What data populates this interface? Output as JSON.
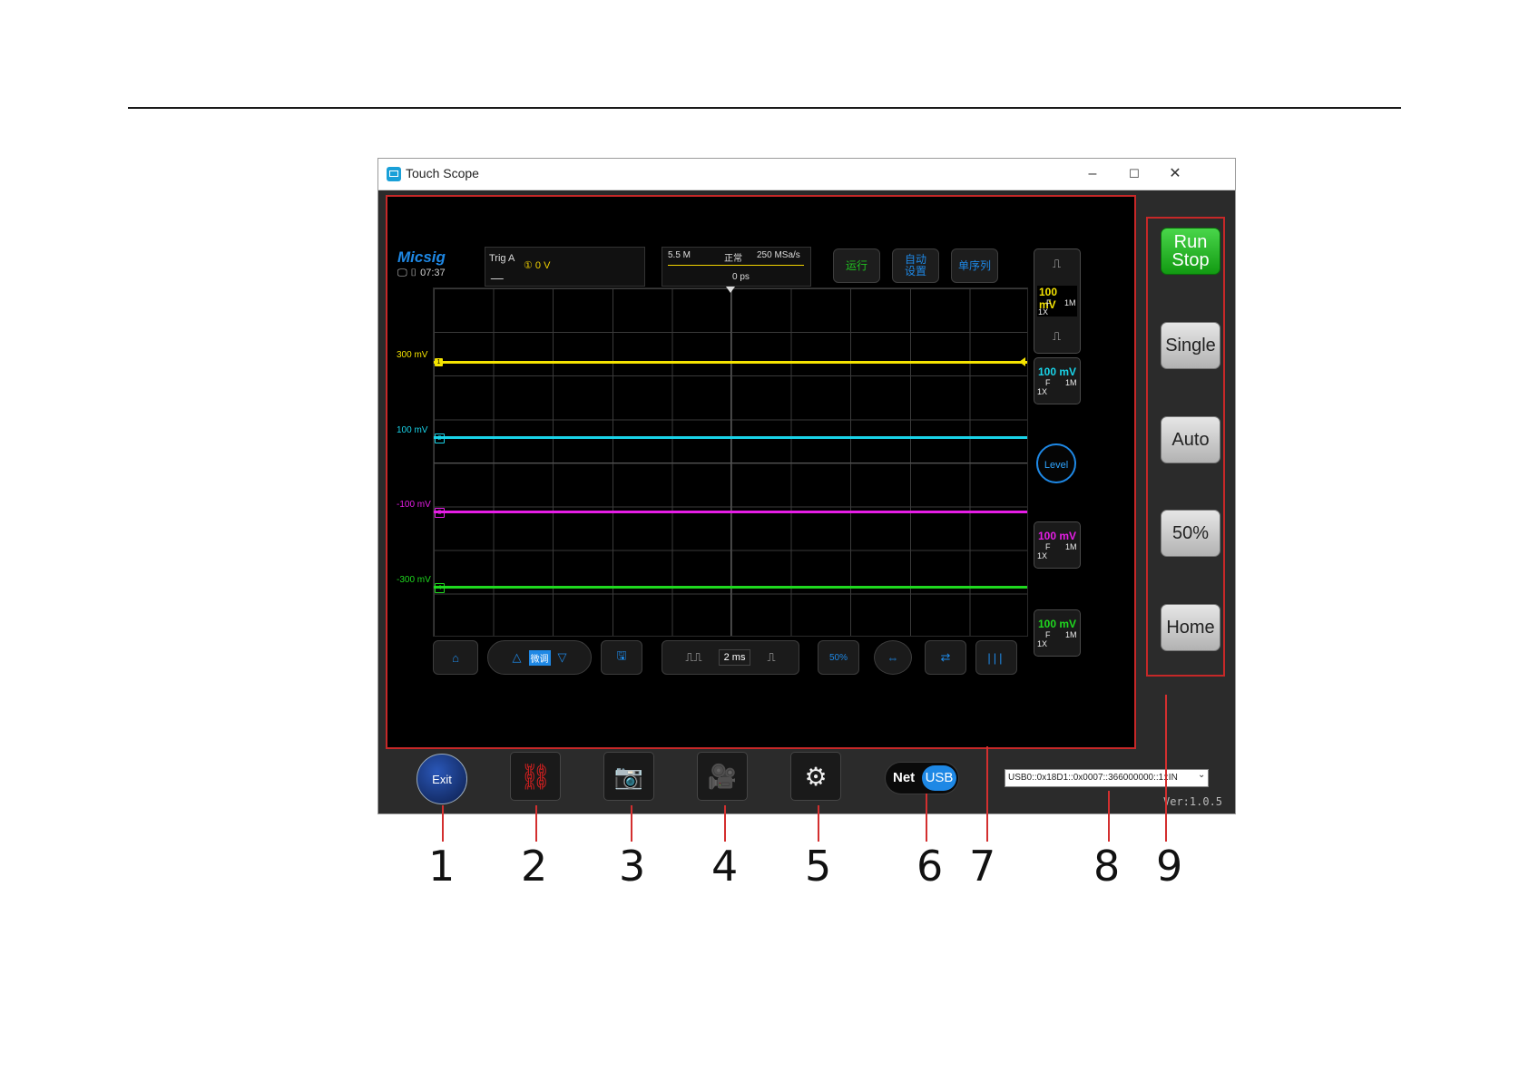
{
  "window": {
    "title": "Touch Scope",
    "min_glyph": "–",
    "max_glyph": "☐",
    "close_glyph": "✕"
  },
  "scope": {
    "logo": "Micsig",
    "clock": "07:37",
    "trigger": {
      "label": "Trig  A",
      "value": "① 0  V"
    },
    "timebase": {
      "memory": "5.5 M",
      "mode": "正常",
      "sample_rate": "250 MSa/s",
      "position": "0 ps"
    },
    "top_buttons": [
      "运行",
      "自动\n设置",
      "单序列"
    ],
    "channels": [
      {
        "offset_label": "300 mV",
        "mark": "1",
        "color": "#f4e300",
        "volts": "100 mV",
        "coupling": "F",
        "impedance": "1M",
        "probe": "1X"
      },
      {
        "offset_label": "100 mV",
        "mark": "2",
        "color": "#19d3e8",
        "volts": "100 mV",
        "coupling": "F",
        "impedance": "1M",
        "probe": "1X"
      },
      {
        "offset_label": "-100 mV",
        "mark": "3",
        "color": "#e61de6",
        "volts": "100 mV",
        "coupling": "F",
        "impedance": "1M",
        "probe": "1X"
      },
      {
        "offset_label": "-300 mV",
        "mark": "4",
        "color": "#1fd81f",
        "volts": "100 mV",
        "coupling": "F",
        "impedance": "1M",
        "probe": "1X"
      }
    ],
    "level_label": "Level",
    "fine_label": "微调",
    "time_div": "2 ms",
    "fifty_label": "50%"
  },
  "right_panel": {
    "run_stop": "Run\nStop",
    "single": "Single",
    "auto": "Auto",
    "fifty": "50%",
    "home": "Home"
  },
  "bottom_bar": {
    "exit": "Exit",
    "net": "Net",
    "usb": "USB",
    "device": "USB0::0x18D1::0x0007::366000000::1::IN",
    "version": "Ver:1.0.5"
  },
  "callouts": [
    "1",
    "2",
    "3",
    "4",
    "5",
    "6",
    "7",
    "8",
    "9"
  ]
}
